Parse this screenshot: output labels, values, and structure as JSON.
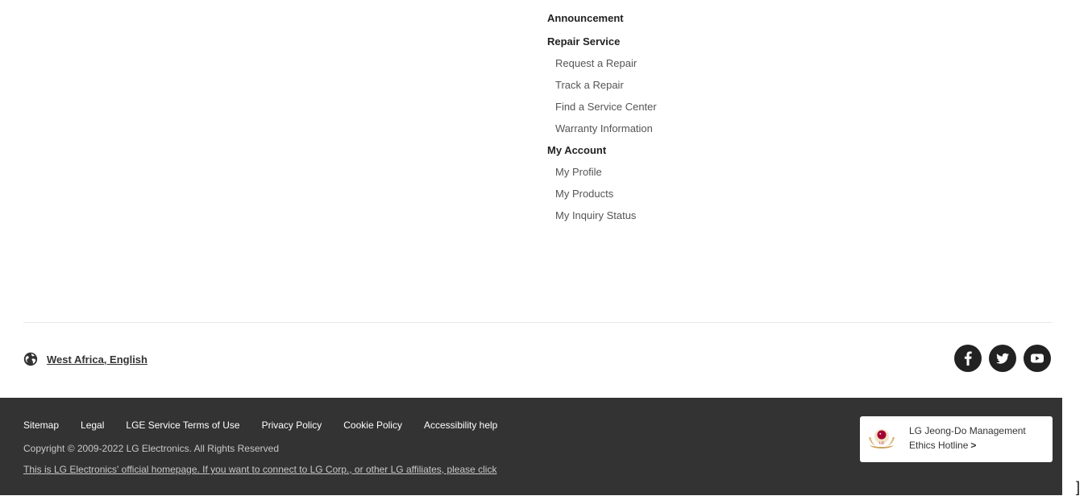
{
  "menu": {
    "announcement": "Announcement",
    "repair_service": {
      "heading": "Repair Service",
      "items": [
        "Request a Repair",
        "Track a Repair",
        "Find a Service Center",
        "Warranty Information"
      ]
    },
    "my_account": {
      "heading": "My Account",
      "items": [
        "My Profile",
        "My Products",
        "My Inquiry Status"
      ]
    }
  },
  "locale": {
    "label": "West Africa, English",
    "icon": "globe-icon"
  },
  "social": [
    {
      "name": "facebook",
      "icon": "facebook-icon"
    },
    {
      "name": "twitter",
      "icon": "twitter-icon"
    },
    {
      "name": "youtube",
      "icon": "youtube-icon"
    }
  ],
  "footer": {
    "links": [
      "Sitemap",
      "Legal",
      "LGE Service Terms of Use",
      "Privacy Policy",
      "Cookie Policy",
      "Accessibility help"
    ],
    "copyright": "Copyright © 2009-2022 LG Electronics. All Rights Reserved",
    "notice": "This is LG Electronics' official homepage. If you want to connect to LG Corp., or other LG affiliates, please click",
    "background": "#333333"
  },
  "hotline": {
    "line1": "LG Jeong-Do Management",
    "line2": "Ethics Hotline",
    "chevron": ">",
    "icon": "lg-emblem-icon",
    "brand_color": "#a50034"
  },
  "edge_mark": "]"
}
